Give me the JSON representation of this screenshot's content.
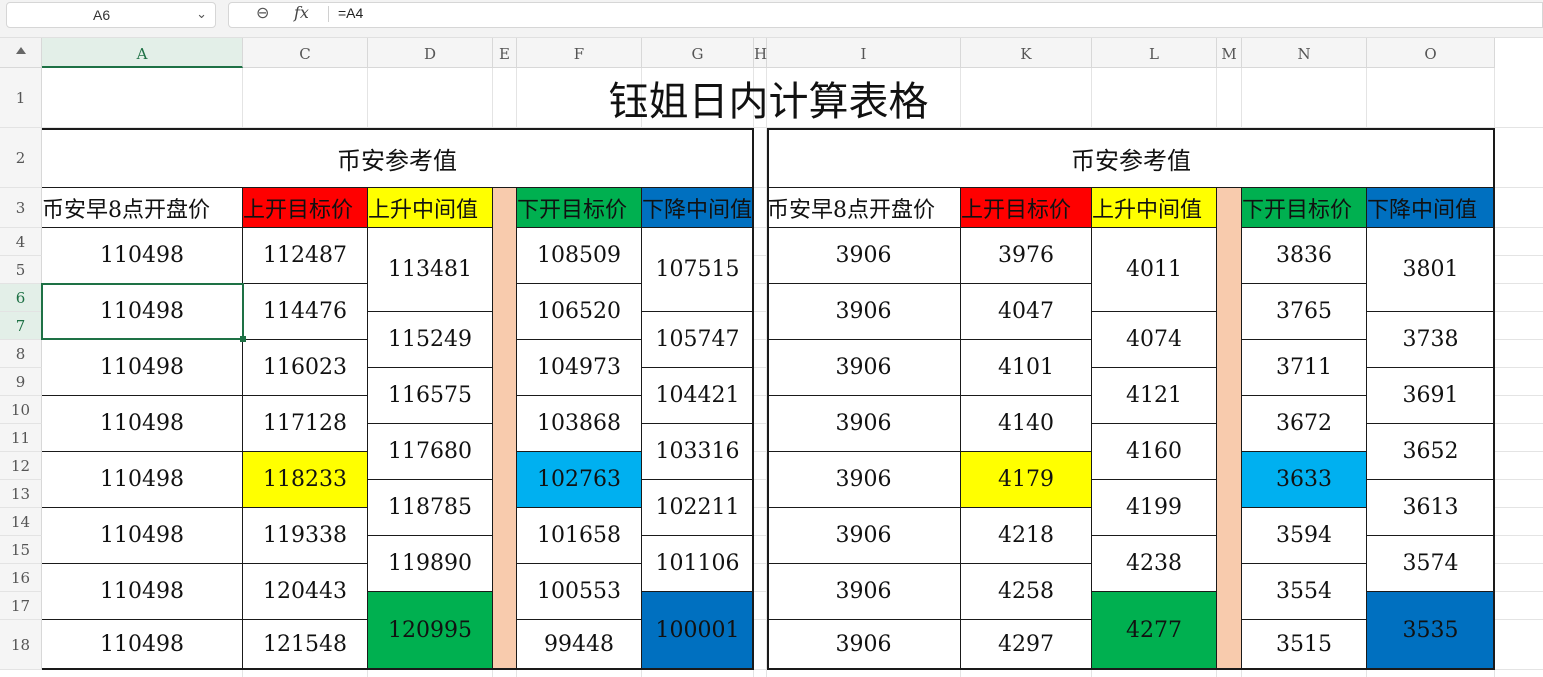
{
  "formula_bar": {
    "name_box": "A6",
    "name_box_icon": "chevron-down-icon",
    "zoom_icon": "zoom-out-icon",
    "fx_label": "fx",
    "formula": "=A4"
  },
  "columns": [
    "A",
    "C",
    "D",
    "E",
    "F",
    "G",
    "H",
    "I",
    "K",
    "L",
    "M",
    "N",
    "O"
  ],
  "rows": [
    "1",
    "2",
    "3",
    "4",
    "5",
    "6",
    "7",
    "8",
    "9",
    "10",
    "11",
    "12",
    "13",
    "14",
    "15",
    "16",
    "17",
    "18"
  ],
  "sheet": {
    "title": "钰姐日内计算表格",
    "left": {
      "section_title": "币安参考值",
      "headers": [
        "币安早8点开盘价",
        "上开目标价",
        "上升中间值",
        "下开目标价",
        "下降中间值"
      ],
      "open_price": [
        "110498",
        "110498",
        "110498",
        "110498",
        "110498",
        "110498",
        "110498",
        "110498"
      ],
      "up_target": [
        "112487",
        "114476",
        "116023",
        "117128",
        "118233",
        "119338",
        "120443",
        "121548"
      ],
      "up_mid": [
        "113481",
        "115249",
        "116575",
        "117680",
        "118785",
        "119890",
        "120995"
      ],
      "down_target": [
        "108509",
        "106520",
        "104973",
        "103868",
        "102763",
        "101658",
        "100553",
        "99448"
      ],
      "down_mid": [
        "107515",
        "105747",
        "104421",
        "103316",
        "102211",
        "101106",
        "100001"
      ]
    },
    "right": {
      "section_title": "币安参考值",
      "headers": [
        "币安早8点开盘价",
        "上开目标价",
        "上升中间值",
        "下开目标价",
        "下降中间值"
      ],
      "open_price": [
        "3906",
        "3906",
        "3906",
        "3906",
        "3906",
        "3906",
        "3906",
        "3906"
      ],
      "up_target": [
        "3976",
        "4047",
        "4101",
        "4140",
        "4179",
        "4218",
        "4258",
        "4297"
      ],
      "up_mid": [
        "4011",
        "4074",
        "4121",
        "4160",
        "4199",
        "4238",
        "4277"
      ],
      "down_target": [
        "3836",
        "3765",
        "3711",
        "3672",
        "3633",
        "3594",
        "3554",
        "3515"
      ],
      "down_mid": [
        "3801",
        "3738",
        "3691",
        "3652",
        "3613",
        "3574",
        "3535"
      ]
    }
  },
  "colors": {
    "red": "#ff0000",
    "yellow": "#ffff00",
    "green": "#00b050",
    "blue": "#0070c0",
    "cyan": "#00b0f0",
    "peach": "#f8cbad",
    "select_green": "#1e7145"
  }
}
